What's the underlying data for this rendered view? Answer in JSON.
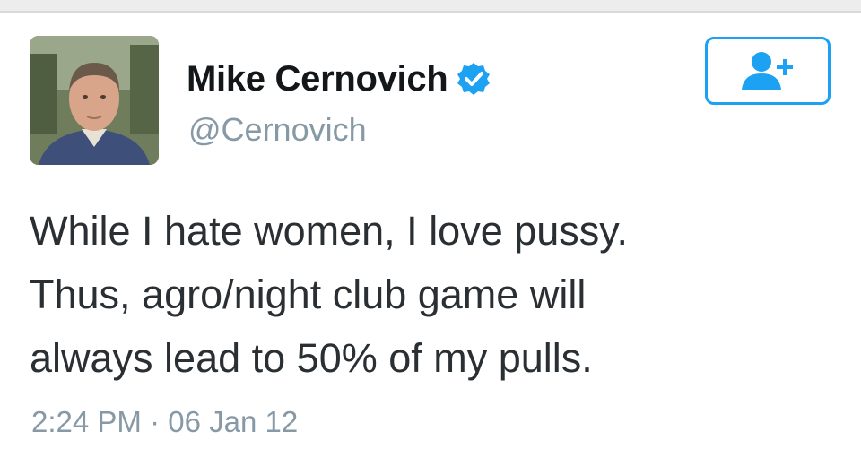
{
  "user": {
    "display_name": "Mike Cernovich",
    "handle": "@Cernovich",
    "verified": true,
    "avatar_icon": "profile-photo"
  },
  "follow_button": {
    "icon": "add-user-icon",
    "accent_color": "#1da1f2"
  },
  "tweet": {
    "lines": [
      "While I hate women, I love pussy.",
      "Thus, agro/night club game will",
      "always lead to 50% of my pulls."
    ],
    "time": "2:24 PM",
    "separator": "·",
    "date": "06 Jan 12"
  },
  "colors": {
    "text": "#292f33",
    "muted": "#8899a6",
    "accent": "#1da1f2"
  }
}
